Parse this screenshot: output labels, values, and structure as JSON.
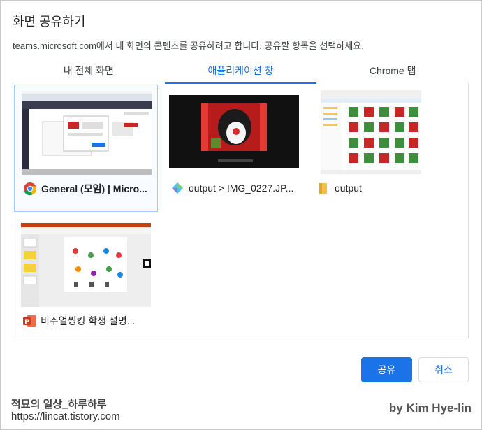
{
  "dialog": {
    "title": "화면 공유하기",
    "subtitle": "teams.microsoft.com에서 내 화면의 콘텐츠를 공유하려고 합니다. 공유할 항목을 선택하세요."
  },
  "tabs": [
    {
      "label": "내 전체 화면",
      "active": false
    },
    {
      "label": "애플리케이션 창",
      "active": true
    },
    {
      "label": "Chrome 탭",
      "active": false
    }
  ],
  "windows": [
    {
      "label": "General (모임) | Micro...",
      "icon": "chrome-icon",
      "selected": true
    },
    {
      "label": "output > IMG_0227.JP...",
      "icon": "image-viewer-icon",
      "selected": false
    },
    {
      "label": "output",
      "icon": "folder-icon",
      "selected": false
    },
    {
      "label": "비주얼씽킹 학생 설명...",
      "icon": "powerpoint-icon",
      "selected": false
    }
  ],
  "buttons": {
    "share": "공유",
    "cancel": "취소"
  },
  "watermark": {
    "line1": "적묘의 일상_하루하루",
    "line2": "https://lincat.tistory.com",
    "author": "by Kim Hye-lin"
  },
  "colors": {
    "accent": "#1a73e8",
    "border": "#dadce0"
  }
}
